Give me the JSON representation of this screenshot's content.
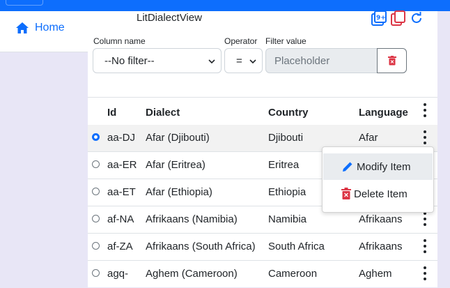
{
  "sidebar": {
    "home_label": "Home"
  },
  "view": {
    "title": "LitDialectView"
  },
  "filter": {
    "column_label": "Column name",
    "operator_label": "Operator",
    "value_label": "Filter value",
    "column_value": "--No filter--",
    "operator_value": "=",
    "value_placeholder": "Placeholder"
  },
  "table": {
    "headers": [
      "Id",
      "Dialect",
      "Country",
      "Language"
    ],
    "rows": [
      {
        "id": "aa-DJ",
        "dialect": "Afar (Djibouti)",
        "country": "Djibouti",
        "language": "Afar",
        "selected": true
      },
      {
        "id": "aa-ER",
        "dialect": "Afar (Eritrea)",
        "country": "Eritrea",
        "language": "",
        "selected": false
      },
      {
        "id": "aa-ET",
        "dialect": "Afar (Ethiopia)",
        "country": "Ethiopia",
        "language": "",
        "selected": false
      },
      {
        "id": "af-NA",
        "dialect": "Afrikaans (Namibia)",
        "country": "Namibia",
        "language": "Afrikaans",
        "selected": false
      },
      {
        "id": "af-ZA",
        "dialect": "Afrikaans (South Africa)",
        "country": "South Africa",
        "language": "Afrikaans",
        "selected": false
      },
      {
        "id": "agq-",
        "dialect": "Aghem (Cameroon)",
        "country": "Cameroon",
        "language": "Aghem",
        "selected": false
      }
    ]
  },
  "context_menu": {
    "modify_label": "Modify Item",
    "delete_label": "Delete Item"
  },
  "colors": {
    "primary": "#0d6efd",
    "danger": "#dc3545"
  }
}
